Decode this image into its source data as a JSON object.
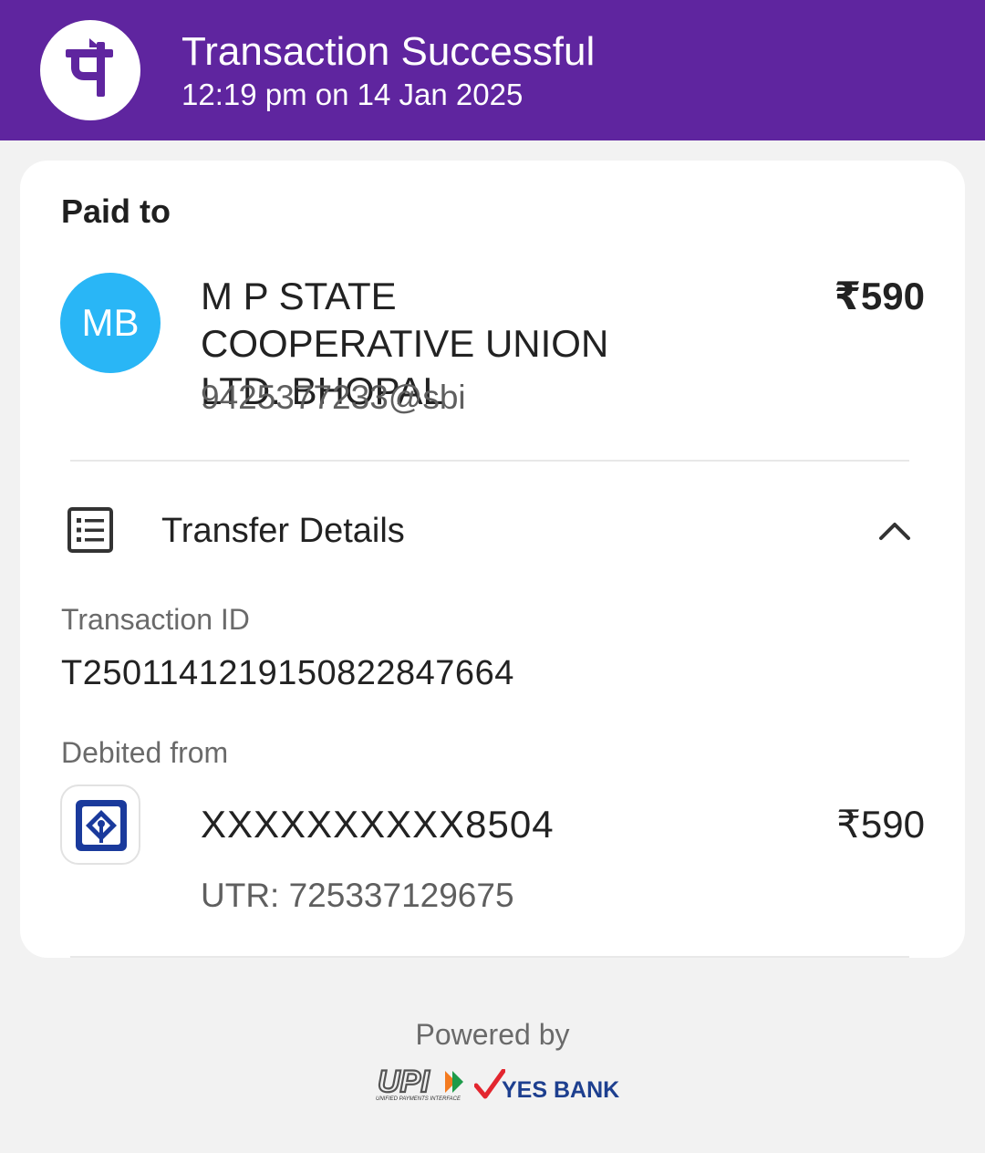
{
  "header": {
    "title": "Transaction Successful",
    "datetime": "12:19 pm on 14 Jan 2025",
    "logo_icon": "phonepe-logo-icon",
    "background_color": "#5f259f"
  },
  "paid_to": {
    "section_label": "Paid to",
    "avatar_initials": "MB",
    "avatar_color": "#29b6f6",
    "payee_name": "M P STATE COOPERATIVE UNION LTD. BHOPAL",
    "amount": "₹590",
    "upi_id": "9425377233@sbi"
  },
  "transfer_details": {
    "title": "Transfer Details",
    "icon": "receipt-list-icon",
    "toggle_icon": "chevron-up-icon",
    "transaction_id_label": "Transaction ID",
    "transaction_id": "T2501141219150822847664",
    "debited_from_label": "Debited from",
    "bank_icon": "sbi-bank-icon",
    "account_number": "XXXXXXXXXX8504",
    "debited_amount": "₹590",
    "utr": "UTR: 725337129675"
  },
  "footer": {
    "powered_by": "Powered by",
    "upi_logo_text": "UPI",
    "upi_logo_subtext": "UNIFIED PAYMENTS INTERFACE",
    "bank_partner": "YES BANK"
  }
}
